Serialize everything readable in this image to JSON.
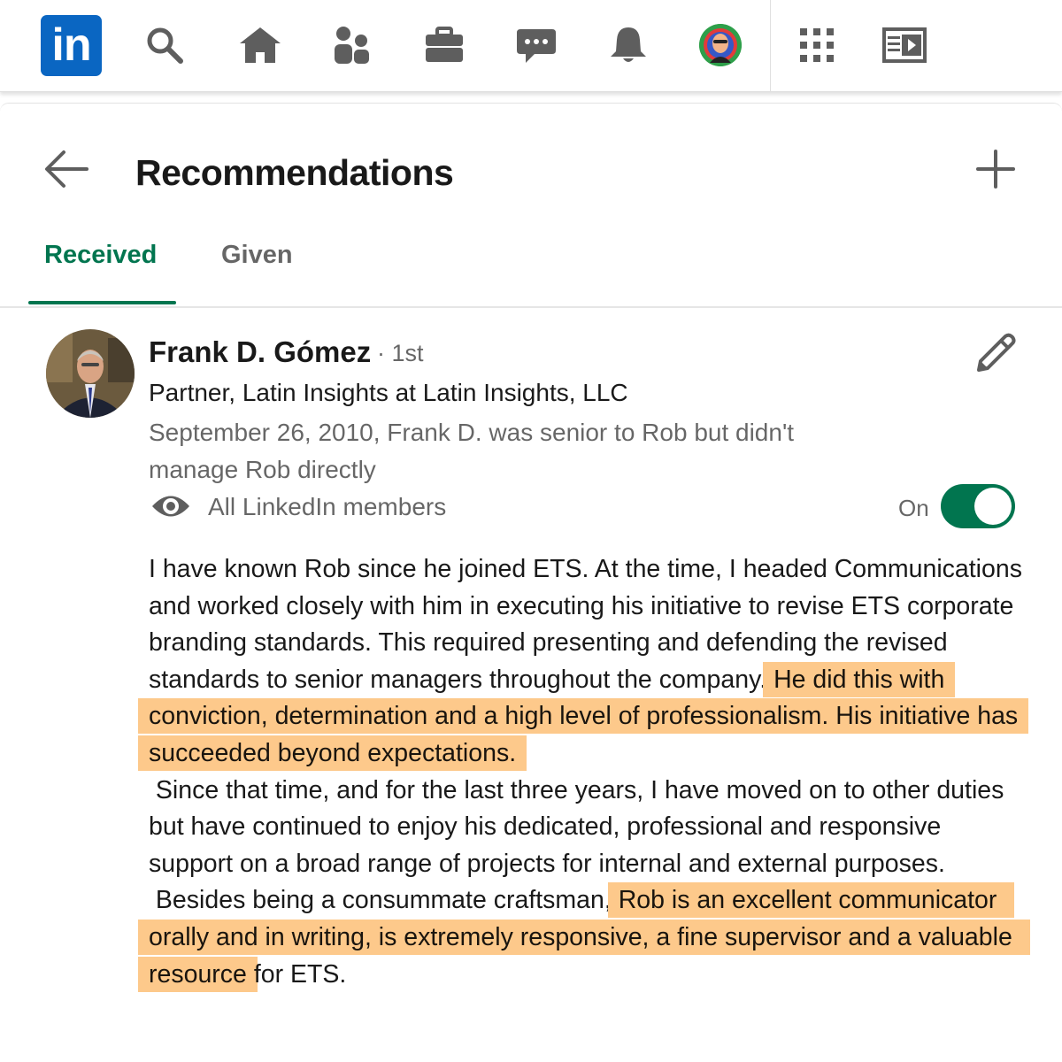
{
  "nav": {
    "logo_text": "in",
    "icons": [
      "linkedin-logo",
      "search-icon",
      "home-icon",
      "network-icon",
      "jobs-icon",
      "messaging-icon",
      "notifications-icon",
      "me-avatar",
      "apps-grid-icon",
      "learning-icon"
    ]
  },
  "header": {
    "title": "Recommendations"
  },
  "tabs": [
    {
      "label": "Received",
      "active": true
    },
    {
      "label": "Given",
      "active": false
    }
  ],
  "recommendation": {
    "name": "Frank D. Gómez",
    "degree": "· 1st",
    "headline": "Partner, Latin Insights at Latin Insights, LLC",
    "meta": "September 26, 2010, Frank D. was senior to Rob but didn't manage Rob directly",
    "visibility": "All LinkedIn members",
    "toggle_label": "On",
    "toggle_on": true,
    "body": {
      "p1_a": "I have known Rob since he joined ETS. At the time, I headed Communications and worked closely with him in executing his initiative to revise ETS corporate branding standards. This required presenting and defending the revised standards to senior managers throughout the company.",
      "p1_hl": "He did this with conviction, determination and a high level of professionalism. His initiative has succeeded beyond expectations.",
      "p2": " Since that time, and for the last three years, I have moved on to other duties but have continued to enjoy his dedicated, professional and responsive support on a broad range of projects for internal and external purposes.",
      "p3_a": " Besides being a consummate craftsman,",
      "p3_hl": "Rob is an excellent communicator orally and in writing, is extremely responsive, a fine supervisor and a valuable resource",
      "p3_b": "for ETS."
    }
  },
  "colors": {
    "brand_blue": "#0a66c2",
    "accent_green": "#01754f",
    "highlight": "#fdc98b"
  }
}
